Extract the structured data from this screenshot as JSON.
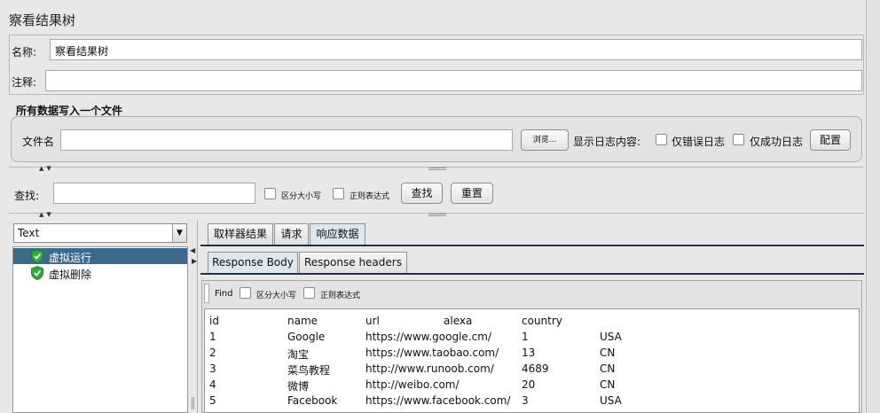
{
  "window": {
    "title": "察看结果树"
  },
  "name_field": {
    "label": "名称:",
    "value": "察看结果树"
  },
  "comment_field": {
    "label": "注释:",
    "value": ""
  },
  "file_section": {
    "title": "所有数据写入一个文件",
    "filename_label": "文件名",
    "filename_value": "",
    "browse_label": "浏览...",
    "log_content_label": "显示日志内容:",
    "errors_only_label": "仅错误日志",
    "success_only_label": "仅成功日志",
    "configure_label": "配置"
  },
  "search": {
    "label": "查找:",
    "value": "",
    "case_sensitive_label": "区分大小写",
    "regex_label": "正则表达式",
    "find_button": "查找",
    "reset_button": "重置"
  },
  "renderer": {
    "selected": "Text"
  },
  "tree": {
    "items": [
      {
        "label": "虚拟运行",
        "selected": true
      },
      {
        "label": "虚拟删除",
        "selected": false
      }
    ]
  },
  "tabs": {
    "main": [
      "取样器结果",
      "请求",
      "响应数据"
    ],
    "active_main": 2,
    "sub": [
      "Response Body",
      "Response headers"
    ],
    "active_sub": 0
  },
  "response_find": {
    "label": "Find",
    "case_sensitive_label": "区分大小写",
    "regex_label": "正则表达式"
  },
  "response_table": {
    "headers": [
      "id",
      "name",
      "url",
      "alexa",
      "country"
    ],
    "rows": [
      [
        "1",
        "Google",
        "https://www.google.cm/",
        "1",
        "USA"
      ],
      [
        "2",
        "淘宝",
        "https://www.taobao.com/",
        "13",
        "CN"
      ],
      [
        "3",
        "菜鸟教程",
        "http://www.runoob.com/",
        "4689",
        "CN"
      ],
      [
        "4",
        "微博",
        "http://weibo.com/",
        "20",
        "CN"
      ],
      [
        "5",
        "Facebook",
        "https://www.facebook.com/",
        "3",
        "USA"
      ]
    ]
  },
  "colors": {
    "selection": "#3d6a8c",
    "tab_underline": "#23304a",
    "shield_green": "#2eaa3a"
  }
}
